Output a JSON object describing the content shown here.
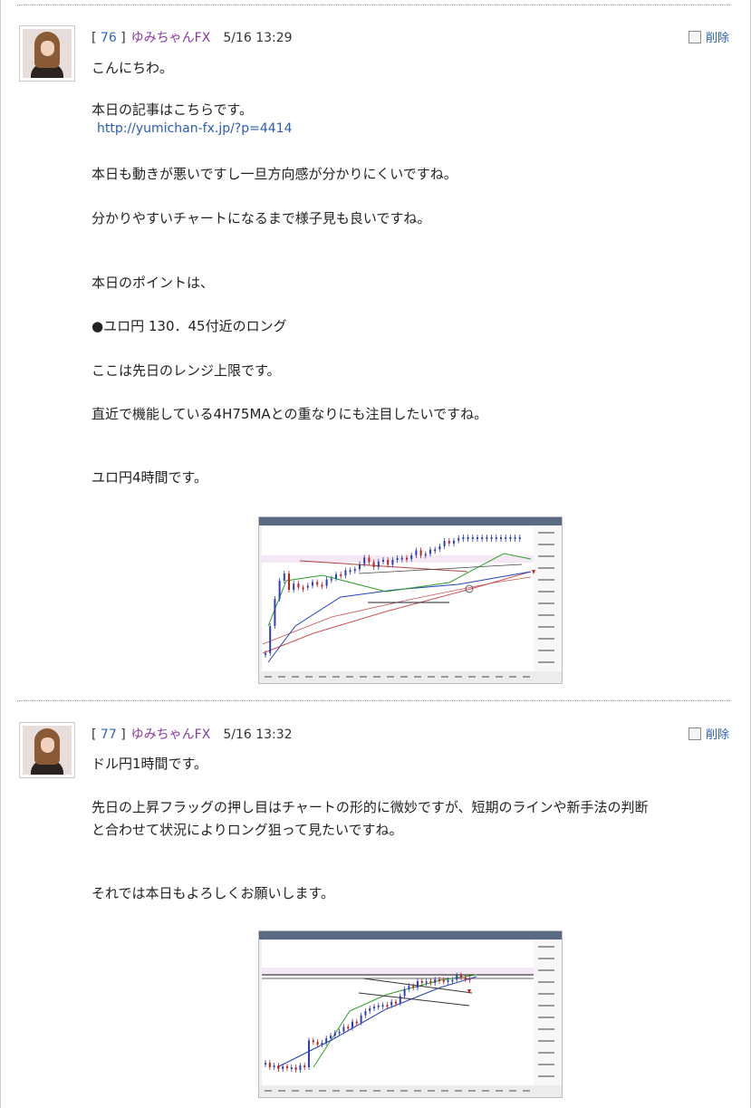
{
  "posts": [
    {
      "number": "76",
      "author": "ゆみちゃんFX",
      "datetime": "5/16 13:29",
      "delete_label": "削除",
      "lines": [
        "こんにちわ。",
        "本日の記事はこちらです。",
        "http://yumichan-fx.jp/?p=4414",
        "本日も動きが悪いですし一旦方向感が分かりにくいですね。",
        "分かりやすいチャートになるまで様子見も良いですね。",
        "本日のポイントは、",
        "●ユロ円 130．45付近のロング",
        "ここは先日のレンジ上限です。",
        "直近で機能している4H75MAとの重なりにも注目したいですね。",
        "ユロ円4時間です。"
      ]
    },
    {
      "number": "77",
      "author": "ゆみちゃんFX",
      "datetime": "5/16 13:32",
      "delete_label": "削除",
      "lines": [
        "ドル円1時間です。",
        "先日の上昇フラッグの押し目はチャートの形的に微妙ですが、短期のラインや新手法の判断",
        "と合わせて状況によりロング狙って見たいですね。",
        "それでは本日もよろしくお願いします。"
      ]
    }
  ],
  "colors": {
    "link": "#2a5db0",
    "number": "#2f66c2",
    "author": "#8a3aa2",
    "bull_candle": "#3040b8",
    "bear_candle": "#c02020",
    "ma_green": "#2aa02a",
    "ma_blue": "#2040c0",
    "ma_red": "#d05050"
  }
}
